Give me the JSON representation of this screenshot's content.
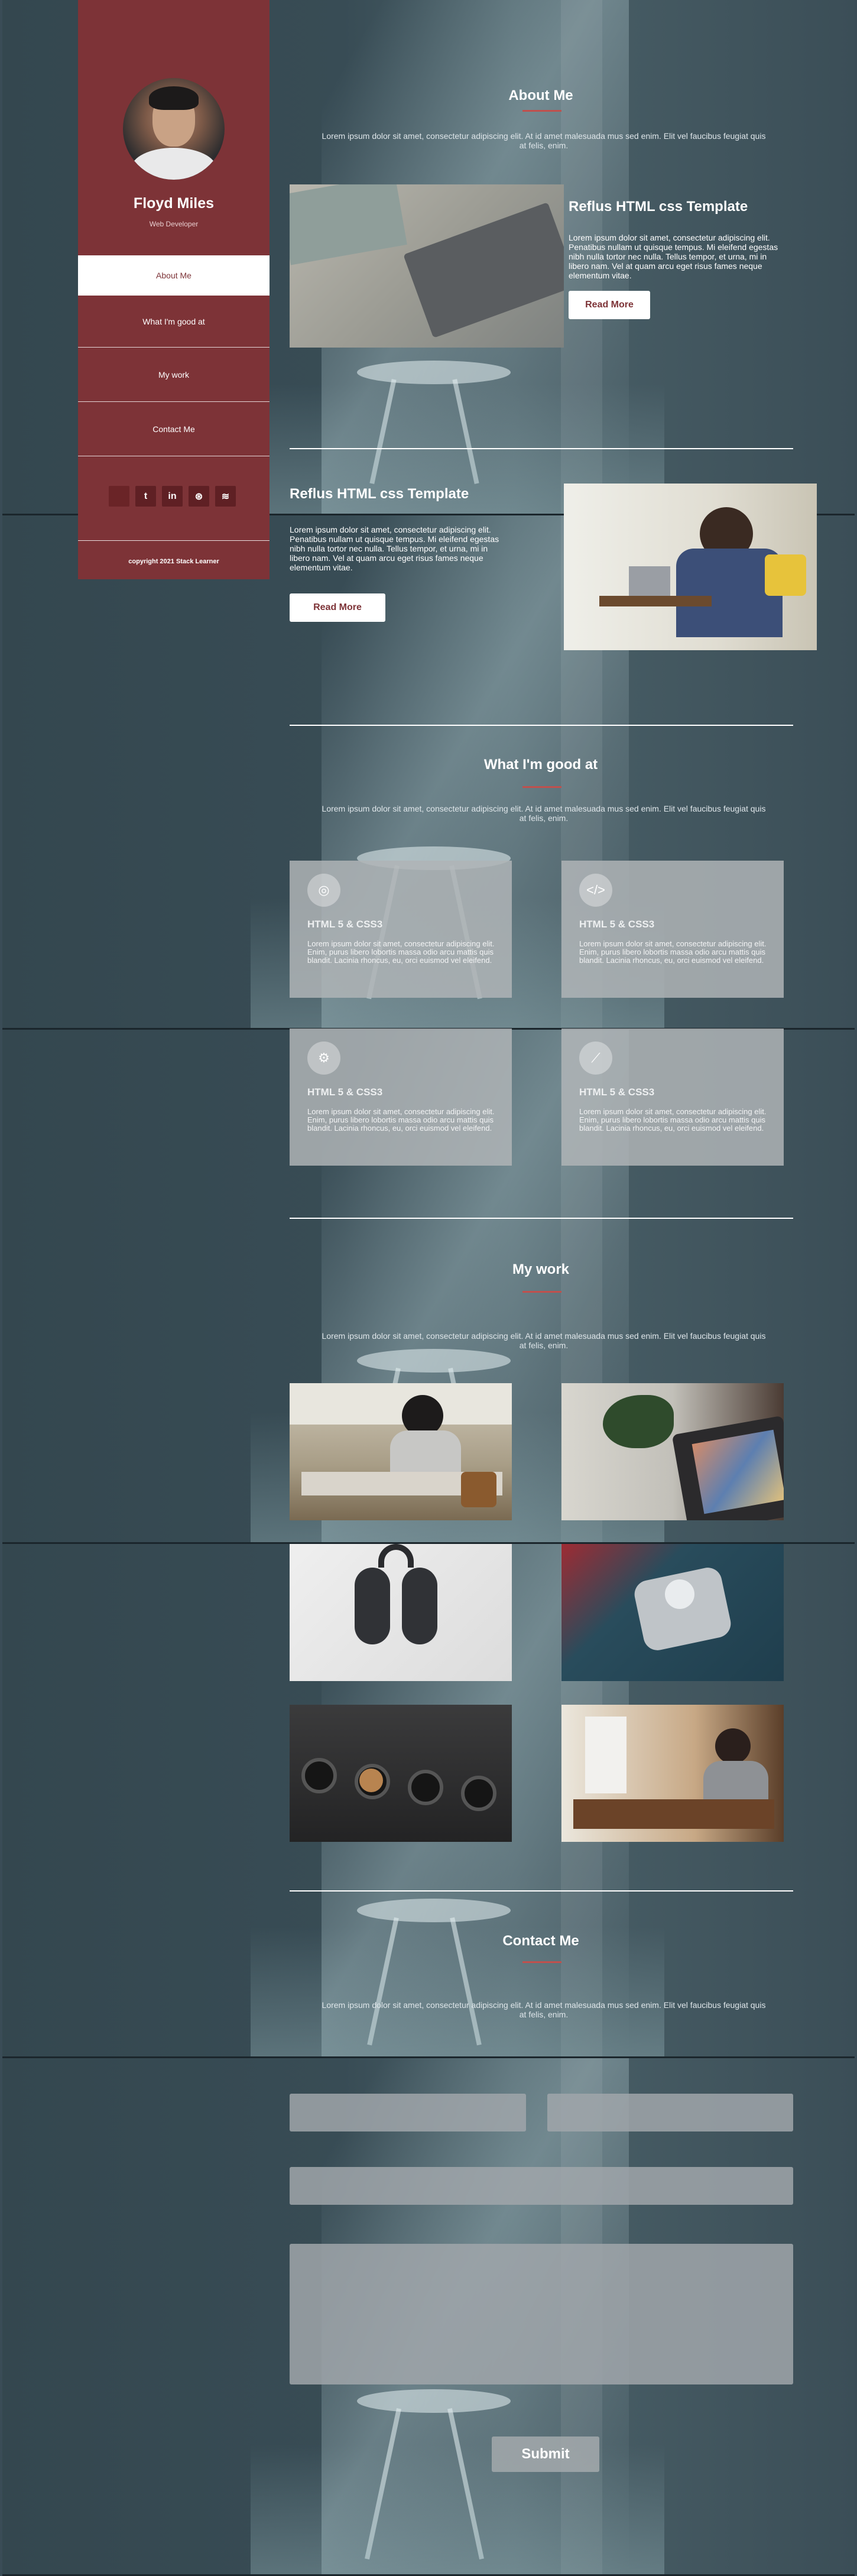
{
  "profile": {
    "name": "Floyd Miles",
    "role": "Web Developer"
  },
  "nav": {
    "items": [
      {
        "label": "About Me",
        "active": true
      },
      {
        "label": "What I'm good at",
        "active": false
      },
      {
        "label": "My work",
        "active": false
      },
      {
        "label": "Contact Me",
        "active": false
      }
    ]
  },
  "social": {
    "icons": [
      "facebook-icon",
      "twitter-icon",
      "linkedin-icon",
      "dribbble-icon",
      "rss-icon"
    ],
    "glyphs": [
      "",
      "t",
      "in",
      "⊛",
      "≋"
    ]
  },
  "footer": {
    "copyright": "copyright 2021 Stack Learner"
  },
  "about": {
    "title": "About Me",
    "lead": "Lorem ipsum dolor sit amet, consectetur adipiscing elit. At id amet malesuada mus sed enim. Elit vel faucibus feugiat quis at felis, enim.",
    "cards": [
      {
        "title": "Reflus HTML css Template",
        "text": "Lorem ipsum dolor sit amet, consectetur adipiscing elit. Penatibus nullam ut quisque tempus. Mi eleifend egestas nibh nulla tortor nec nulla. Tellus tempor, et urna, mi in libero nam. Vel at quam arcu eget risus fames neque elementum vitae.",
        "button": "Read More"
      },
      {
        "title": "Reflus HTML css Template",
        "text": "Lorem ipsum dolor sit amet, consectetur adipiscing elit. Penatibus nullam ut quisque tempus. Mi eleifend egestas nibh nulla tortor nec nulla. Tellus tempor, et urna, mi in libero nam. Vel at quam arcu eget risus fames neque elementum vitae.",
        "button": "Read More"
      }
    ]
  },
  "skills": {
    "title": "What I'm good at",
    "lead": "Lorem ipsum dolor sit amet, consectetur adipiscing elit. At id amet malesuada mus sed enim. Elit vel faucibus feugiat quis at felis, enim.",
    "items": [
      {
        "icon": "lightbulb-icon",
        "glyph": "◎",
        "title": "HTML 5 & CSS3",
        "text": "Lorem ipsum dolor sit amet, consectetur adipiscing elit. Enim, purus libero lobortis massa odio arcu mattis quis blandit. Lacinia rhoncus, eu, orci euismod vel eleifend."
      },
      {
        "icon": "code-icon",
        "glyph": "</>",
        "title": "HTML 5 & CSS3",
        "text": "Lorem ipsum dolor sit amet, consectetur adipiscing elit. Enim, purus libero lobortis massa odio arcu mattis quis blandit. Lacinia rhoncus, eu, orci euismod vel eleifend."
      },
      {
        "icon": "gear-icon",
        "glyph": "⚙",
        "title": "HTML 5 & CSS3",
        "text": "Lorem ipsum dolor sit amet, consectetur adipiscing elit. Enim, purus libero lobortis massa odio arcu mattis quis blandit. Lacinia rhoncus, eu, orci euismod vel eleifend."
      },
      {
        "icon": "chart-icon",
        "glyph": "⟋",
        "title": "HTML 5 & CSS3",
        "text": "Lorem ipsum dolor sit amet, consectetur adipiscing elit. Enim, purus libero lobortis massa odio arcu mattis quis blandit. Lacinia rhoncus, eu, orci euismod vel eleifend."
      }
    ]
  },
  "work": {
    "title": "My work",
    "lead": "Lorem ipsum dolor sit amet, consectetur adipiscing elit. At id amet malesuada mus sed enim. Elit vel faucibus feugiat quis at felis, enim."
  },
  "contact": {
    "title": "Contact Me",
    "lead": "Lorem ipsum dolor sit amet, consectetur adipiscing elit. At id amet malesuada mus sed enim. Elit vel faucibus feugiat quis at felis, enim.",
    "submit": "Submit"
  },
  "colors": {
    "sidebar": "#7d3337",
    "accent": "#c0504d",
    "background": "#3a4c56"
  }
}
